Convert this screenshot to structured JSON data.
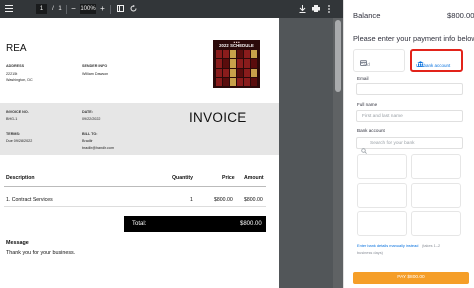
{
  "viewer": {
    "toolbar": {
      "menu_icon": "menu-icon",
      "page_current": "1",
      "page_separator": "/",
      "page_total": "1",
      "zoom_out": "−",
      "zoom_level": "100%",
      "zoom_in": "+",
      "fit_icon": "fit-page-icon",
      "rotate_icon": "rotate-icon",
      "download_icon": "download-icon",
      "print_icon": "print-icon",
      "more_icon": "more-vertical-icon"
    }
  },
  "invoice": {
    "company": "REA",
    "address_label": "ADDRESS",
    "address_line1": "22215t",
    "address_line2": "Washington, DC",
    "sender_label": "SENDER INFO",
    "sender_name": "William Dawson",
    "schedule_image_title": "2022 SCHEDULE",
    "invoice_no_label": "INVOICE NO.",
    "invoice_no": "BHG-1",
    "date_label": "DATE:",
    "date": "09/22/2022",
    "terms_label": "TERMS:",
    "terms": "Due 09/28/2022",
    "bill_to_label": "BILL TO:",
    "bill_to_name": "Bradlir",
    "bill_to_email": "bradlir@handlr.com",
    "title": "INVOICE",
    "columns": {
      "description": "Description",
      "quantity": "Quantity",
      "price": "Price",
      "amount": "Amount"
    },
    "items": [
      {
        "description": "1. Contract Services",
        "quantity": "1",
        "price": "$800.00",
        "amount": "$800.00"
      }
    ],
    "total_label": "Total:",
    "total_value": "$800.00",
    "message_label": "Message",
    "message_text": "Thank you for your business."
  },
  "payment": {
    "balance_label": "Balance",
    "balance_amount": "$800.00",
    "prompt": "Please enter your payment info below:",
    "tabs": [
      {
        "label": "Card",
        "icon": "card-icon"
      },
      {
        "label": "US bank account",
        "icon": "bank-icon"
      }
    ],
    "email_label": "Email",
    "fullname_label": "Full name",
    "fullname_placeholder": "First and last name",
    "bank_label": "Bank account",
    "bank_search_placeholder": "Search for your bank",
    "manual_link": "Enter bank details manually instead",
    "manual_tail": "(takes 1–2",
    "manual_sub": "business days)",
    "pay_button": "PAY $800.00",
    "accent_color": "#0570de",
    "highlight_color": "#e2231a",
    "pay_color": "#f59e28"
  }
}
